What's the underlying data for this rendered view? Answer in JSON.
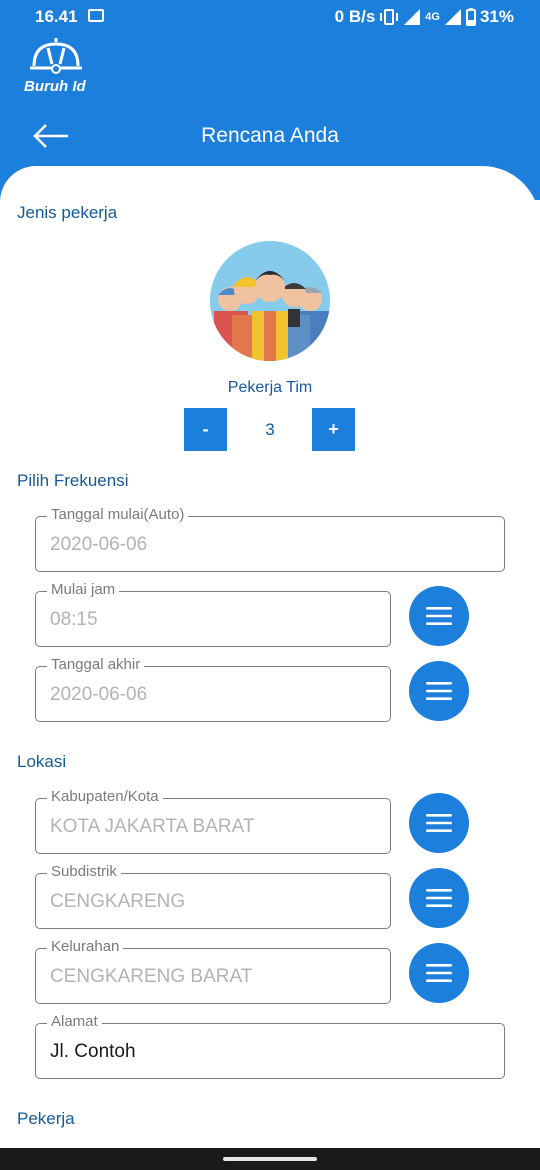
{
  "status_bar": {
    "time": "16.41",
    "net_speed": "0 B/s",
    "network_type": "4G",
    "battery": "31%"
  },
  "header": {
    "logo_text": "Buruh Id",
    "title": "Rencana Anda",
    "back_icon": "arrow-left-icon"
  },
  "worker_type": {
    "section_title": "Jenis pekerja",
    "label": "Pekerja Tim",
    "decrement_label": "-",
    "increment_label": "+",
    "count": "3"
  },
  "frequency": {
    "section_title": "Pilih Frekuensi",
    "fields": [
      {
        "label": "Tanggal mulai(Auto)",
        "value": "2020-06-06"
      },
      {
        "label": "Mulai jam",
        "value": "08:15"
      },
      {
        "label": "Tanggal akhir",
        "value": "2020-06-06"
      }
    ]
  },
  "location": {
    "section_title": "Lokasi",
    "fields": [
      {
        "label": "Kabupaten/Kota",
        "value": "KOTA JAKARTA BARAT"
      },
      {
        "label": "Subdistrik",
        "value": "CENGKARENG"
      },
      {
        "label": "Kelurahan",
        "value": "CENGKARENG BARAT"
      },
      {
        "label": "Alamat",
        "value": "Jl. Contoh"
      }
    ]
  },
  "workers": {
    "section_title": "Pekerja"
  },
  "colors": {
    "primary": "#1c7fdb",
    "section_text": "#155a9a"
  }
}
